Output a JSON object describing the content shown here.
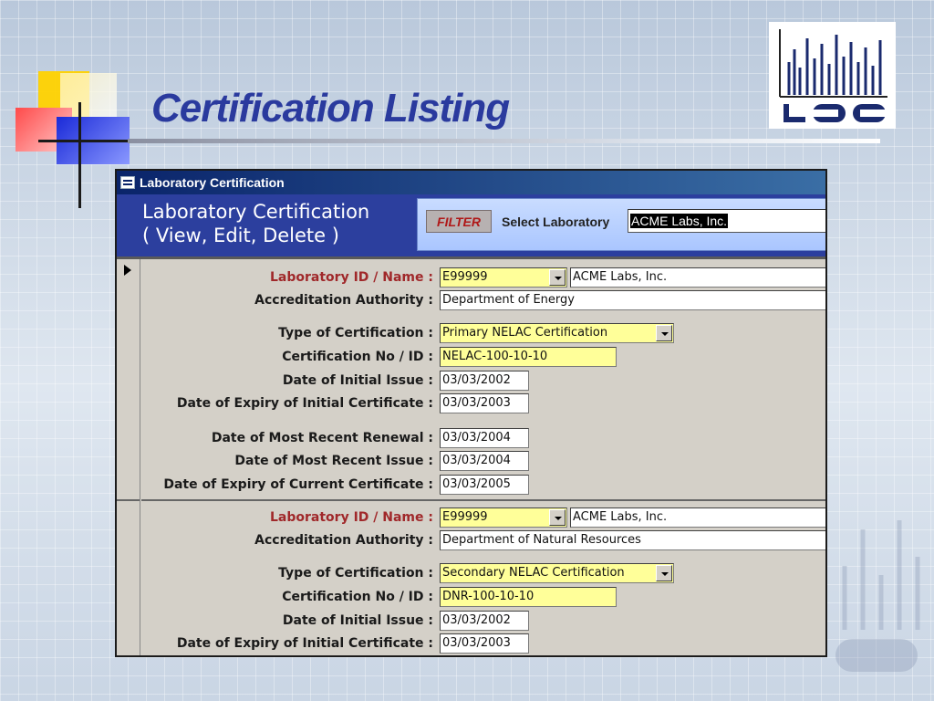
{
  "slide": {
    "title": "Certification Listing",
    "logo_text": "LDC"
  },
  "window": {
    "title": "Laboratory Certification",
    "header_line1": "Laboratory Certification",
    "header_line2": "( View, Edit, Delete )",
    "filter_button": "FILTER",
    "select_label": "Select Laboratory",
    "select_value": "ACME Labs, Inc."
  },
  "labels": {
    "lab_id": "Laboratory ID / Name :",
    "authority": "Accreditation Authority :",
    "type": "Type of Certification :",
    "cert_no": "Certification No / ID :",
    "initial_issue": "Date of Initial Issue :",
    "expiry_initial": "Date of Expiry of Initial Certificate :",
    "recent_renewal": "Date of Most Recent Renewal :",
    "recent_issue": "Date of Most Recent Issue :",
    "expiry_current": "Date of Expiry of Current Certificate :"
  },
  "records": [
    {
      "lab_id": "E99999",
      "lab_name": "ACME Labs, Inc.",
      "authority": "Department of Energy",
      "type": "Primary NELAC Certification",
      "cert_no": "NELAC-100-10-10",
      "initial_issue": "03/03/2002",
      "expiry_initial": "03/03/2003",
      "recent_renewal": "03/03/2004",
      "recent_issue": "03/03/2004",
      "expiry_current": "03/03/2005"
    },
    {
      "lab_id": "E99999",
      "lab_name": "ACME Labs, Inc.",
      "authority": "Department of Natural Resources",
      "type": "Secondary NELAC Certification",
      "cert_no": "DNR-100-10-10",
      "initial_issue": "03/03/2002",
      "expiry_initial": "03/03/2003"
    }
  ],
  "colors": {
    "title": "#2a3a9e",
    "header_bg": "#2c3f9e",
    "required_field": "#ffff99",
    "required_label": "#a0282a"
  }
}
